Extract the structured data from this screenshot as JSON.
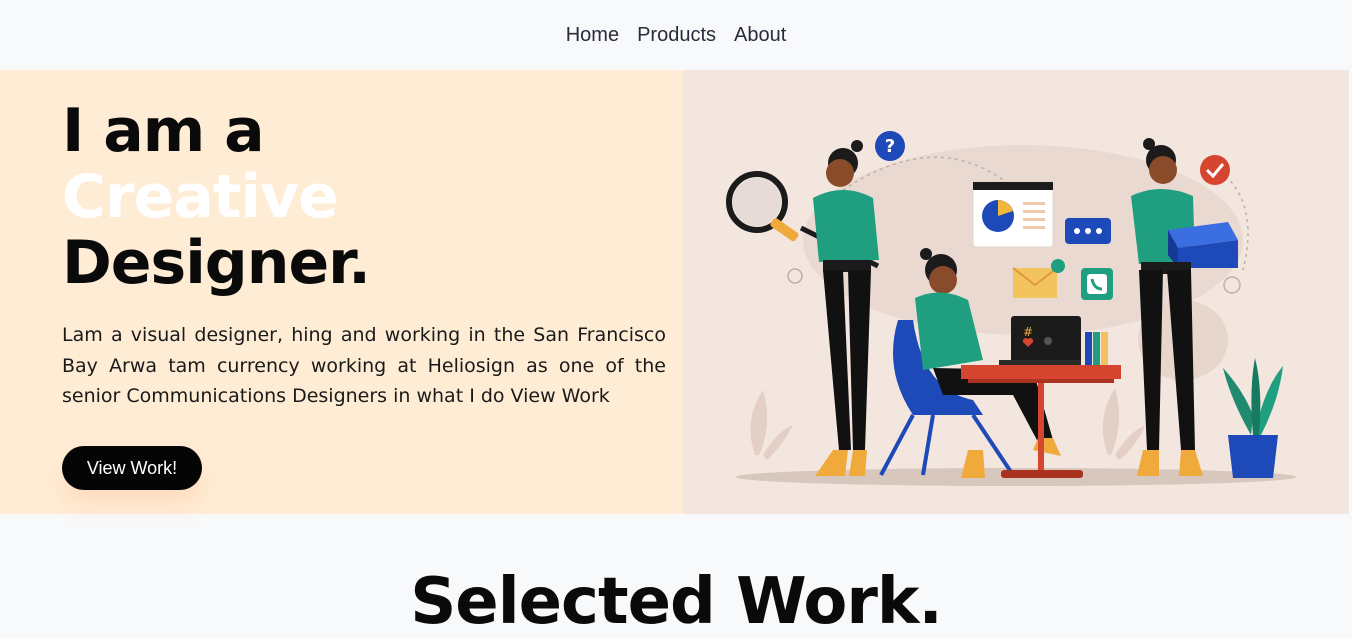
{
  "nav": {
    "items": [
      {
        "label": "Home"
      },
      {
        "label": "Products"
      },
      {
        "label": "About"
      }
    ]
  },
  "hero": {
    "line1": "I am a",
    "line2": "Creative",
    "line3": "Designer.",
    "bio": "Lam a visual designer, hing and working in the San Francisco Bay Arwa tam currency working at Heliosign as one of the senior Communications Designers in what I do View Work",
    "cta": "View Work!"
  },
  "section": {
    "title": "Selected Work."
  },
  "colors": {
    "hero_left_bg": "#ffecd5",
    "hero_right_bg": "#f3e6de",
    "accent_green": "#1f9f80",
    "accent_blue": "#1e49b8",
    "accent_red": "#d6452f"
  },
  "illustration": {
    "icons": [
      "magnifier-icon",
      "question-icon",
      "check-badge-icon",
      "chat-bubble-icon",
      "mail-icon",
      "phone-icon",
      "laptop-icon",
      "globe-icon",
      "plant-icon"
    ]
  }
}
